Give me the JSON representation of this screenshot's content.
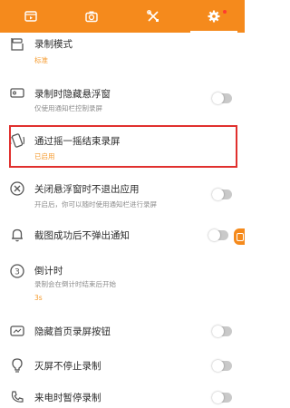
{
  "tabs": [
    {
      "icon": "screen-record-icon"
    },
    {
      "icon": "camera-icon"
    },
    {
      "icon": "tools-icon"
    },
    {
      "icon": "gear-icon",
      "active": true,
      "badge_color": "#ff3b30"
    }
  ],
  "settings": {
    "record_mode": {
      "title": "录制模式",
      "value": "标准"
    },
    "hide_float": {
      "title": "录制时隐藏悬浮窗",
      "desc": "仅使用通知栏控制录屏",
      "enabled": false
    },
    "shake_stop": {
      "title": "通过摇一摇结束录屏",
      "value": "已启用"
    },
    "close_float": {
      "title": "关闭悬浮窗时不退出应用",
      "desc": "开启后，你可以随时使用通知栏进行录屏",
      "enabled": false
    },
    "no_notify": {
      "title": "截图成功后不弹出通知",
      "enabled": false
    },
    "countdown": {
      "title": "倒计时",
      "desc": "录制会在倒计时结束后开始",
      "value": "3s"
    },
    "hide_home_btn": {
      "title": "隐藏首页录屏按钮",
      "enabled": false
    },
    "screen_off": {
      "title": "灭屏不停止录制",
      "enabled": false
    },
    "call_pause": {
      "title": "来电时暂停录制",
      "enabled": false
    }
  },
  "colors": {
    "accent": "#f58a1c",
    "highlight": "#e0302e"
  }
}
